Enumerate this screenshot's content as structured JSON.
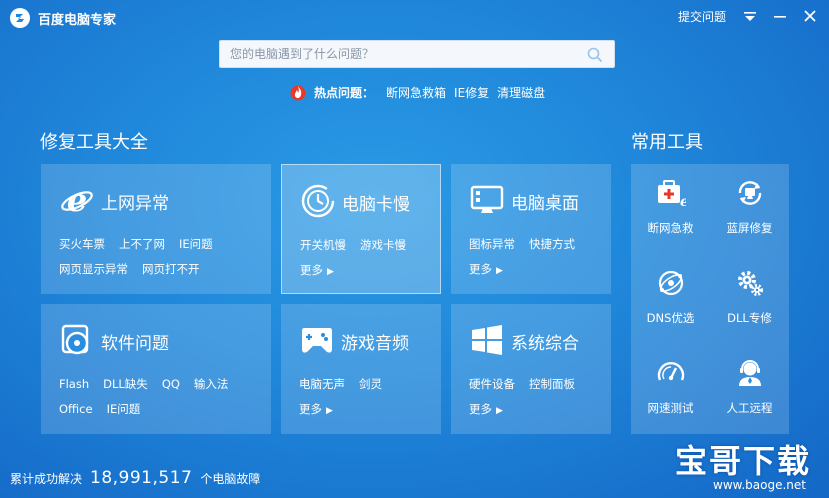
{
  "window": {
    "title": "百度电脑专家",
    "feedback": "提交问题"
  },
  "search": {
    "placeholder": "您的电脑遇到了什么问题？"
  },
  "hot": {
    "label": "热点问题：",
    "links": [
      "断网急救箱",
      "IE修复",
      "清理磁盘"
    ]
  },
  "repair": {
    "title": "修复工具大全",
    "more": "更多",
    "cards": [
      {
        "title": "上网异常",
        "icon": "ie-icon",
        "rows": [
          [
            "买火车票",
            "上不了网",
            "IE问题"
          ],
          [
            "网页显示异常",
            "网页打不开"
          ]
        ]
      },
      {
        "title": "电脑卡慢",
        "icon": "clock-icon",
        "rows": [
          [
            "开关机慢",
            "游戏卡慢"
          ]
        ]
      },
      {
        "title": "电脑桌面",
        "icon": "monitor-icon",
        "rows": [
          [
            "图标异常",
            "快捷方式"
          ]
        ]
      },
      {
        "title": "软件问题",
        "icon": "disc-icon",
        "rows": [
          [
            "Flash",
            "DLL缺失",
            "QQ",
            "输入法"
          ],
          [
            "Office",
            "IE问题"
          ]
        ]
      },
      {
        "title": "游戏音频",
        "icon": "gamepad-icon",
        "rows": [
          [
            "电脑无声",
            "剑灵"
          ]
        ]
      },
      {
        "title": "系统综合",
        "icon": "windows-icon",
        "rows": [
          [
            "硬件设备",
            "控制面板"
          ]
        ]
      }
    ]
  },
  "tools": {
    "title": "常用工具",
    "items": [
      {
        "label": "断网急救",
        "icon": "network-aid-icon"
      },
      {
        "label": "蓝屏修复",
        "icon": "bluescreen-repair-icon"
      },
      {
        "label": "DNS优选",
        "icon": "dns-icon"
      },
      {
        "label": "DLL专修",
        "icon": "gears-icon"
      },
      {
        "label": "网速测试",
        "icon": "speedometer-icon"
      },
      {
        "label": "人工远程",
        "icon": "support-agent-icon"
      }
    ]
  },
  "footer": {
    "prefix": "累计成功解决",
    "count": "18,991,517",
    "suffix": "个电脑故障"
  },
  "watermark": {
    "text": "宝哥下载",
    "url": "www.baoge.net"
  }
}
